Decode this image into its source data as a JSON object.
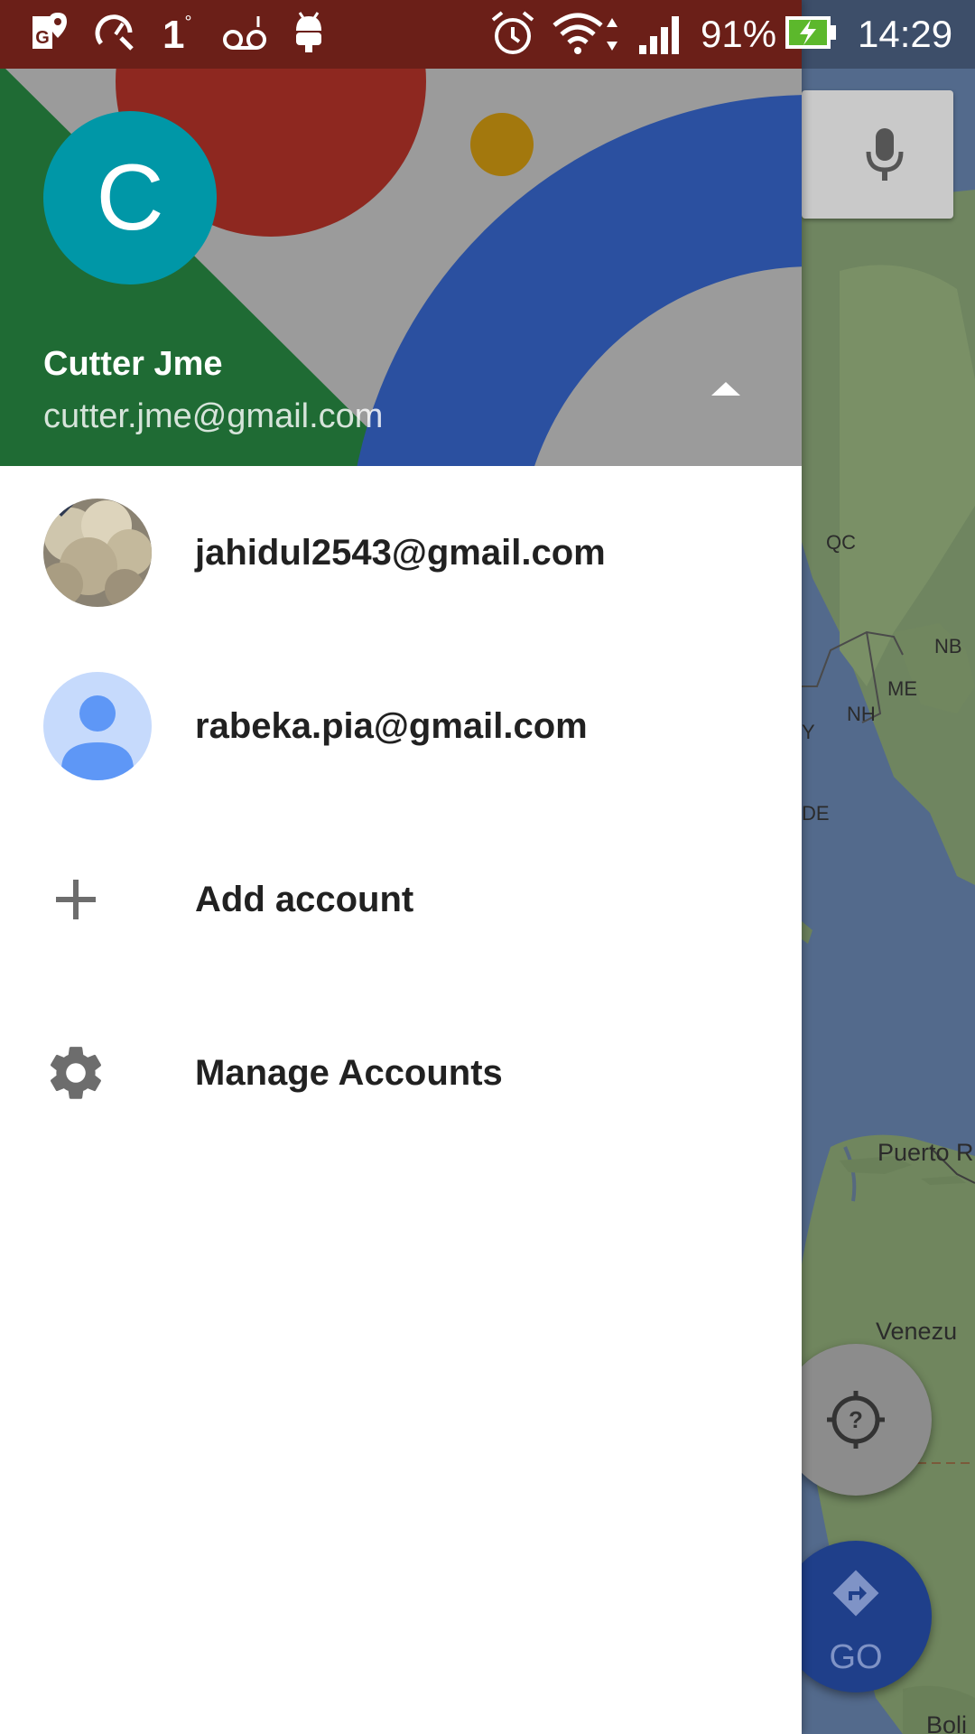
{
  "status_bar": {
    "temperature": "1",
    "temperature_unit": "°",
    "battery": "91%",
    "time": "14:29"
  },
  "drawer": {
    "header": {
      "avatar_letter": "C",
      "name": "Cutter Jme",
      "email": "cutter.jme@gmail.com"
    },
    "accounts": [
      {
        "email": "jahidul2543@gmail.com"
      },
      {
        "email": "rabeka.pia@gmail.com"
      }
    ],
    "actions": {
      "add_account": "Add account",
      "manage_accounts": "Manage Accounts"
    }
  },
  "map": {
    "labels": [
      "QC",
      "NB",
      "ME",
      "NH",
      "Y",
      "DE",
      "Puerto R",
      "Venezu",
      "Boli"
    ],
    "go_label": "GO"
  },
  "colors": {
    "avatar_bg": "#0097a7",
    "status_bar_bg": "#6b1f18",
    "go_button": "#1f3f8a"
  }
}
